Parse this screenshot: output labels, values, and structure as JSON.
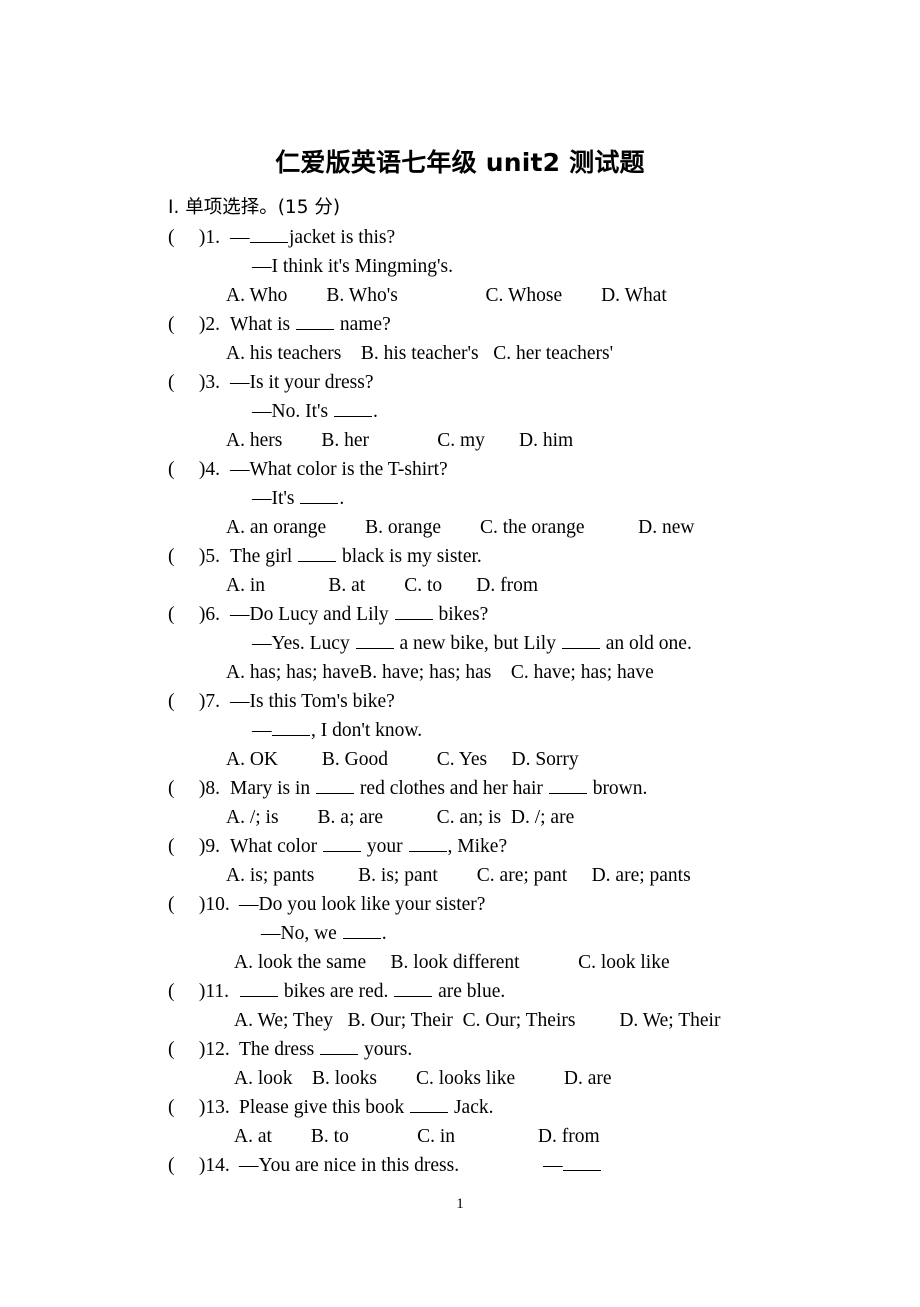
{
  "document": {
    "title": "仁爱版英语七年级 unit2 测试题",
    "page_number": "1"
  },
  "section": {
    "heading": "Ⅰ. 单项选择。(15 分)"
  },
  "questions": [
    {
      "number": "1",
      "marker": "(     )1.",
      "stem": "—",
      "stem_tail": "jacket is this?",
      "lines": [
        "—I think it's Mingming's."
      ],
      "options": "A. Who        B. Who's                  C. Whose        D. What"
    },
    {
      "number": "2",
      "marker": "(     )2.",
      "stem_pre": "What is ",
      "stem_tail": " name?",
      "lines": [],
      "options": "A. his teachers    B. his teacher's   C. her teachers'"
    },
    {
      "number": "3",
      "marker": "(     )3.",
      "stem": "—Is it your dress?",
      "lines": [
        "—No. It's "
      ],
      "line_tail": ".",
      "options": "A. hers        B. her              C. my       D. him"
    },
    {
      "number": "4",
      "marker": "(     )4.",
      "stem": "—What color is the T-shirt?",
      "lines": [
        "—It's "
      ],
      "line_tail": ".",
      "options": "A. an orange        B. orange        C. the orange           D. new"
    },
    {
      "number": "5",
      "marker": "(     )5.",
      "stem_pre": "The girl ",
      "stem_tail": " black is my sister.",
      "lines": [],
      "options": "A. in             B. at        C. to       D. from"
    },
    {
      "number": "6",
      "marker": "(     )6.",
      "stem_pre": "—Do Lucy and Lily ",
      "stem_tail": " bikes?",
      "lines": [
        "—Yes. Lucy ",
        " a new bike, but Lily ",
        " an old one."
      ],
      "options": "A. has; has; haveB. have; has; has    C. have; has; have"
    },
    {
      "number": "7",
      "marker": "(     )7.",
      "stem": "—Is this Tom's bike?",
      "lines": [
        "—",
        ", I don't know."
      ],
      "options": "A. OK         B. Good          C. Yes     D. Sorry"
    },
    {
      "number": "8",
      "marker": "(     )8.",
      "stem_pre": "Mary is in ",
      "stem_mid": " red clothes and her hair ",
      "stem_tail": " brown.",
      "lines": [],
      "options": "A. /; is        B. a; are           C. an; is  D. /; are"
    },
    {
      "number": "9",
      "marker": "(     )9.",
      "stem_pre": "What color ",
      "stem_mid": " your ",
      "stem_tail": ", Mike?",
      "lines": [],
      "options": "A. is; pants         B. is; pant        C. are; pant     D. are; pants"
    },
    {
      "number": "10",
      "marker": "(     )10.",
      "stem": "—Do you look like your sister?",
      "lines": [
        "—No, we "
      ],
      "line_tail": ".",
      "options": "A. look the same     B. look different            C. look like"
    },
    {
      "number": "11",
      "marker": "(     )11.",
      "stem_pre": " ",
      "stem_mid": " bikes are red. ",
      "stem_tail": " are blue.",
      "lines": [],
      "options": "A. We; They   B. Our; Their  C. Our; Theirs         D. We; Their"
    },
    {
      "number": "12",
      "marker": "(     )12.",
      "stem_pre": "The dress ",
      "stem_tail": " yours.",
      "lines": [],
      "options": "A. look    B. looks        C. looks like          D. are"
    },
    {
      "number": "13",
      "marker": "(     )13.",
      "stem_pre": "Please give this book ",
      "stem_tail": " Jack.",
      "lines": [],
      "options": "A. at        B. to              C. in                 D. from"
    },
    {
      "number": "14",
      "marker": "(     )14.",
      "stem": "—You are nice in this dress.",
      "stem_trailing_dash": "—",
      "lines": [],
      "options": ""
    }
  ]
}
